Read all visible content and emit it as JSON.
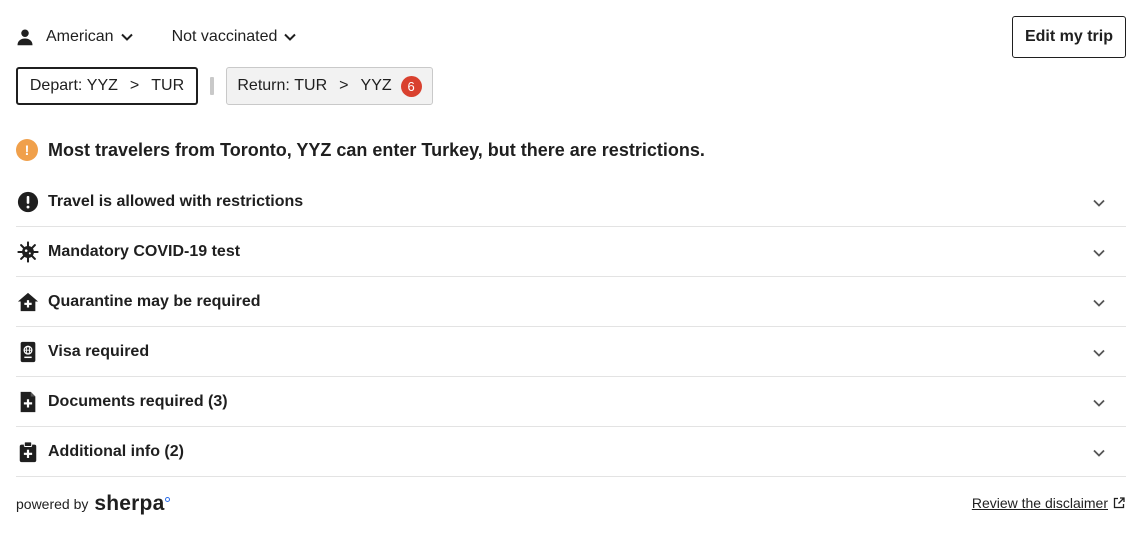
{
  "traveler": {
    "nationality": "American",
    "vaccination": "Not vaccinated"
  },
  "header": {
    "edit_label": "Edit my trip"
  },
  "segments": {
    "depart": {
      "prefix": "Depart:",
      "from": "YYZ",
      "arrow": ">",
      "to": "TUR"
    },
    "return": {
      "prefix": "Return:",
      "from": "TUR",
      "arrow": ">",
      "to": "YYZ",
      "badge": "6"
    }
  },
  "summary": {
    "text": "Most travelers from Toronto, YYZ can enter Turkey, but there are restrictions.",
    "status_icon": "!"
  },
  "items": [
    {
      "label": "Travel is allowed with restrictions",
      "icon": "alert-circle-icon"
    },
    {
      "label": "Mandatory COVID-19 test",
      "icon": "virus-icon"
    },
    {
      "label": "Quarantine may be required",
      "icon": "house-plus-icon"
    },
    {
      "label": "Visa required",
      "icon": "passport-icon"
    },
    {
      "label": "Documents required (3)",
      "icon": "document-plus-icon"
    },
    {
      "label": "Additional info (2)",
      "icon": "clipboard-plus-icon"
    }
  ],
  "footer": {
    "powered_by": "powered by",
    "brand": "sherpa",
    "disclaimer": "Review the disclaimer"
  },
  "colors": {
    "text": "#1f1f1f",
    "badge": "#d9412f",
    "warning": "#f0a04b",
    "brand_dot": "#2d6ee8"
  }
}
